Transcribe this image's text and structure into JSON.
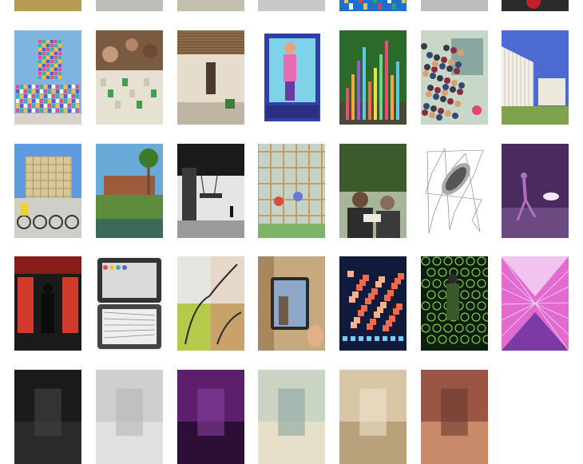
{
  "gallery": {
    "rows": [
      {
        "tiles": [
          {
            "id": "r0c0",
            "theme": "ochre-architecture",
            "colors": [
              "#8f7a3c",
              "#b59b54",
              "#d8c58a"
            ]
          },
          {
            "id": "r0c1",
            "theme": "grey-pavement",
            "colors": [
              "#9c9c94",
              "#bdbdb5",
              "#3c3c3c"
            ]
          },
          {
            "id": "r0c2",
            "theme": "interior-grey",
            "colors": [
              "#8a8478",
              "#c4beaf",
              "#4a4741"
            ]
          },
          {
            "id": "r0c3",
            "theme": "street-grey",
            "colors": [
              "#a3a3a1",
              "#c8c8c6",
              "#5a5a58"
            ]
          },
          {
            "id": "r0c4",
            "theme": "colorful-crowd",
            "colors": [
              "#1f6fd1",
              "#e8402f",
              "#f2c230"
            ]
          },
          {
            "id": "r0c5",
            "theme": "pale-grey",
            "colors": [
              "#d9d9d9",
              "#bcbcbc",
              "#e9e9e9"
            ]
          },
          {
            "id": "r0c6",
            "theme": "red-emblem",
            "colors": [
              "#2b2b2b",
              "#c0202a",
              "#e5e5e5"
            ]
          }
        ]
      },
      {
        "tiles": [
          {
            "id": "r1c0",
            "theme": "colorful-tower-sky",
            "colors": [
              "#6fa7d9",
              "#e84d8a",
              "#3fb0a4"
            ]
          },
          {
            "id": "r1c1",
            "theme": "people-workshop-model",
            "colors": [
              "#8b6a4d",
              "#e7e1d3",
              "#3aa24b"
            ]
          },
          {
            "id": "r1c2",
            "theme": "wooden-interior-room",
            "colors": [
              "#a88863",
              "#e6dccb",
              "#6c5a44"
            ]
          },
          {
            "id": "r1c3",
            "theme": "blue-box-figure",
            "colors": [
              "#3140a8",
              "#7fd3e8",
              "#e96ab5"
            ]
          },
          {
            "id": "r1c4",
            "theme": "color-poles-garden",
            "colors": [
              "#2c6a2a",
              "#e94e77",
              "#f2a93b"
            ]
          },
          {
            "id": "r1c5",
            "theme": "crowd-market",
            "colors": [
              "#3b3b48",
              "#8a2c3f",
              "#c9d7c8"
            ]
          },
          {
            "id": "r1c6",
            "theme": "white-pavilion",
            "colors": [
              "#4c6ad1",
              "#f2efe6",
              "#7fa34a"
            ]
          }
        ]
      },
      {
        "tiles": [
          {
            "id": "r2c0",
            "theme": "lattice-cube-bikes",
            "colors": [
              "#5d9ae0",
              "#d7c79a",
              "#333333"
            ]
          },
          {
            "id": "r2c1",
            "theme": "palm-garden-pond",
            "colors": [
              "#6aa9d8",
              "#5d8c3d",
              "#9c5b3a"
            ]
          },
          {
            "id": "r2c2",
            "theme": "bw-tree-swing",
            "colors": [
              "#1a1a1a",
              "#9a9a9a",
              "#e5e5e5"
            ]
          },
          {
            "id": "r2c3",
            "theme": "timber-scaffold-people",
            "colors": [
              "#c89c5d",
              "#7fb36a",
              "#d94a3a"
            ]
          },
          {
            "id": "r2c4",
            "theme": "men-reading-tree",
            "colors": [
              "#3d5a2c",
              "#2d2d2d",
              "#a8b59a"
            ]
          },
          {
            "id": "r2c5",
            "theme": "voronoi-hand-drawing",
            "colors": [
              "#ffffff",
              "#444444",
              "#aaaaaa"
            ]
          },
          {
            "id": "r2c6",
            "theme": "dancer-purple-stage",
            "colors": [
              "#4a2a5f",
              "#b26fc0",
              "#f0e9ff"
            ]
          }
        ]
      },
      {
        "tiles": [
          {
            "id": "r3c0",
            "theme": "red-room-silhouette",
            "colors": [
              "#8a1b1b",
              "#1a1a1a",
              "#d23b2c"
            ]
          },
          {
            "id": "r3c1",
            "theme": "tablet-sketch-app",
            "colors": [
              "#333333",
              "#d9d9d9",
              "#f3f3f3"
            ]
          },
          {
            "id": "r3c2",
            "theme": "vine-collage",
            "colors": [
              "#b7c94a",
              "#e6d8c8",
              "#2a2a2a"
            ]
          },
          {
            "id": "r3c3",
            "theme": "tablet-street-ar",
            "colors": [
              "#c7a97f",
              "#2a2a2a",
              "#8fa7c8"
            ]
          },
          {
            "id": "r3c4",
            "theme": "orange-data-cubes",
            "colors": [
              "#101a3a",
              "#f06a4b",
              "#6fd0ff"
            ]
          },
          {
            "id": "r3c5",
            "theme": "green-hexagon-figure",
            "colors": [
              "#0c1f0c",
              "#9bea4a",
              "#3b5a2a"
            ]
          },
          {
            "id": "r3c6",
            "theme": "pink-tunnel",
            "colors": [
              "#e26bd0",
              "#7c3aa6",
              "#f3c3ef"
            ]
          }
        ]
      },
      {
        "tiles": [
          {
            "id": "r4c0",
            "theme": "dark",
            "colors": [
              "#1a1a1a",
              "#2a2a2a",
              "#444444"
            ]
          },
          {
            "id": "r4c1",
            "theme": "light-grey",
            "colors": [
              "#cfcfcf",
              "#e0e0e0",
              "#b5b5b5"
            ]
          },
          {
            "id": "r4c2",
            "theme": "purple-dark",
            "colors": [
              "#5b1f6e",
              "#2c0e36",
              "#8a3fa0"
            ]
          },
          {
            "id": "r4c3",
            "theme": "pale-building",
            "colors": [
              "#c9d5c2",
              "#e7e0c8",
              "#8ea3a0"
            ]
          },
          {
            "id": "r4c4",
            "theme": "beige",
            "colors": [
              "#d8c7a6",
              "#b9a27b",
              "#eee2cb"
            ]
          },
          {
            "id": "r4c5",
            "theme": "brown-red",
            "colors": [
              "#9a5544",
              "#c98a6a",
              "#6b3a2f"
            ]
          }
        ]
      }
    ]
  }
}
